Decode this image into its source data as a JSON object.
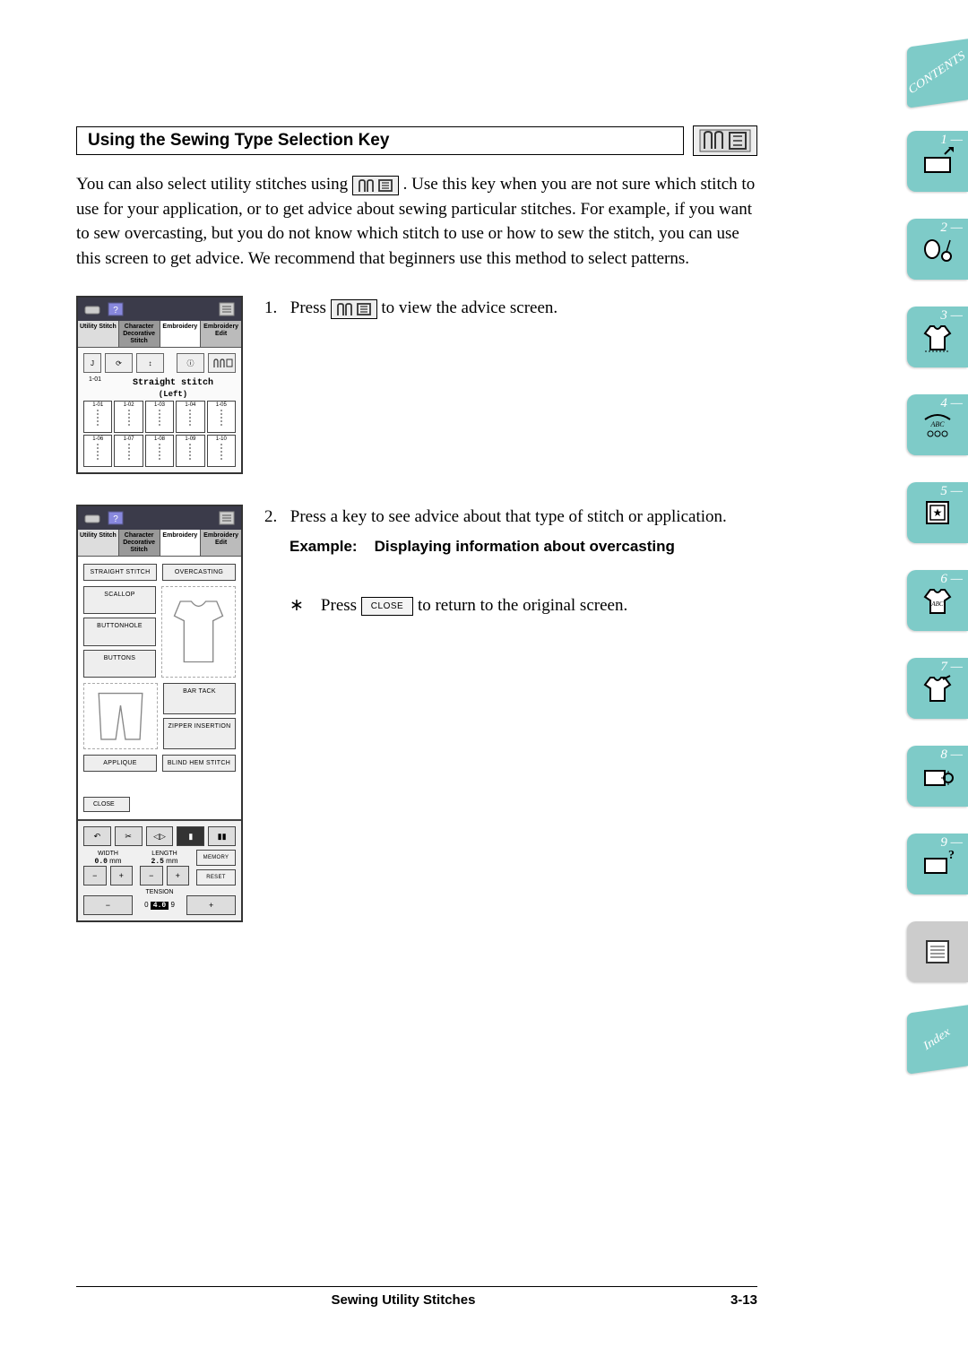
{
  "header": {
    "section_title": "Using the Sewing Type Selection Key"
  },
  "intro": {
    "part1": "You can also select utility stitches using ",
    "part2": ". Use this key when you are not sure which stitch to use for your application, or to get advice about sewing particular stitches. For example, if you want to sew overcasting, but you do not know which stitch to use or how to sew the stitch, you can use this screen to get advice. We recommend that beginners use this method to select patterns."
  },
  "steps": {
    "s1": {
      "num": "1.",
      "text_a": "Press ",
      "text_b": " to view the advice screen."
    },
    "s2": {
      "num": "2.",
      "line1": "Press a key to see advice about that type of stitch or application.",
      "example_label": "Example:",
      "example_text": "Displaying information about overcasting",
      "note_a": "Press ",
      "note_b": " to return to the original screen.",
      "close_label": "CLOSE"
    }
  },
  "panel_common": {
    "tabs": {
      "t1": "Utility Stitch",
      "t2": "Character Decorative Stitch",
      "t3": "Embroidery",
      "t4": "Embroidery Edit"
    }
  },
  "panel1": {
    "stitch_head": "Straight stitch",
    "stitch_sub": "(Left)",
    "code": "1-01",
    "grid": [
      "1-01",
      "1-02",
      "1-03",
      "1-04",
      "1-05",
      "1-06",
      "1-07",
      "1-08",
      "1-09",
      "1-10"
    ]
  },
  "panel2": {
    "buttons": {
      "straight": "STRAIGHT STITCH",
      "overcast": "OVERCASTING",
      "scallop": "SCALLOP",
      "buttonhole": "BUTTONHOLE",
      "buttons": "BUTTONS",
      "bartack": "BAR TACK",
      "zipper": "ZIPPER INSERTION",
      "applique": "APPLIQUE",
      "blindhem": "BLIND HEM STITCH",
      "close": "CLOSE"
    },
    "ctrl": {
      "width_label": "WIDTH",
      "width_val": "0.0",
      "width_unit": "mm",
      "length_label": "LENGTH",
      "length_val": "2.5",
      "length_unit": "mm",
      "tension_label": "TENSION",
      "tension_val": "4.0",
      "t_low": "0",
      "t_high": "9",
      "memory": "MEMORY",
      "reset": "RESET"
    }
  },
  "side_nav": {
    "contents": "CONTENTS",
    "index": "Index",
    "items": [
      "1 —",
      "2 —",
      "3 —",
      "4 —",
      "5 —",
      "6 —",
      "7 —",
      "8 —",
      "9 —"
    ]
  },
  "footer": {
    "title": "Sewing Utility Stitches",
    "page": "3-13"
  }
}
